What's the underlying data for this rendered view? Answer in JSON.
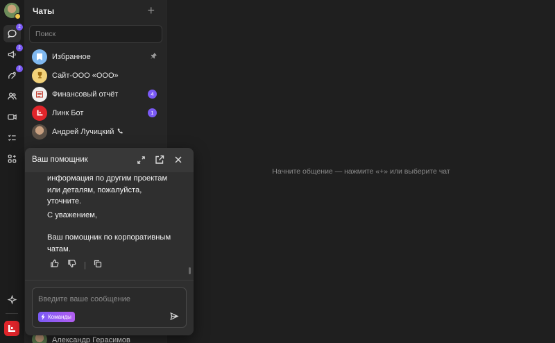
{
  "rail": {
    "items": [
      {
        "name": "chats",
        "icon": "chat-bubble-icon",
        "badge": "2"
      },
      {
        "name": "channels",
        "icon": "megaphone-icon",
        "badge": "2"
      },
      {
        "name": "threads",
        "icon": "thread-icon",
        "badge": "2"
      },
      {
        "name": "contacts",
        "icon": "contacts-icon",
        "badge": ""
      },
      {
        "name": "video",
        "icon": "video-icon",
        "badge": ""
      },
      {
        "name": "tasks",
        "icon": "tasks-icon",
        "badge": ""
      },
      {
        "name": "apps",
        "icon": "apps-icon",
        "badge": ""
      },
      {
        "name": "assistant",
        "icon": "sparkle-icon",
        "badge": ""
      }
    ]
  },
  "chat_list": {
    "title": "Чаты",
    "add_label": "+",
    "search_placeholder": "Поиск",
    "chats": [
      {
        "name": "Избранное",
        "avatar": "bookmark-icon",
        "avatar_color": "#7fb8f0",
        "pinned": true,
        "count": ""
      },
      {
        "name": "Сайт-ООО «ООО»",
        "avatar": "trophy-icon",
        "avatar_color": "#f2d27a",
        "pinned": false,
        "count": ""
      },
      {
        "name": "Финансовый отчёт",
        "avatar": "report-icon",
        "avatar_color": "#f0f0f0",
        "pinned": false,
        "count": "4"
      },
      {
        "name": "Линк Бот",
        "avatar": "link-logo-icon",
        "avatar_color": "#e0252b",
        "pinned": false,
        "count": "1"
      },
      {
        "name": "Андрей Лучицкий",
        "avatar": "person-photo",
        "avatar_color": "#8a7a6a",
        "pinned": false,
        "count": "",
        "phone": true
      }
    ],
    "bottom_chat": "Александр Герасимов"
  },
  "main": {
    "empty_text": "Начните общение — нажмите «+» или выберите чат"
  },
  "assistant": {
    "title": "Ваш помощник",
    "message_lines": [
      "информация по другим проектам",
      "или деталям, пожалуйста,",
      "уточните."
    ],
    "greeting": "С уважением,",
    "signature_lines": [
      "Ваш помощник по корпоративным",
      "чатам."
    ],
    "input_placeholder": "Введите ваше сообщение",
    "commands_label": "Команды"
  },
  "colors": {
    "accent": "#7a5af5",
    "brand": "#e0252b",
    "background": "#1f1f1f",
    "panel": "#2f2f2f"
  }
}
